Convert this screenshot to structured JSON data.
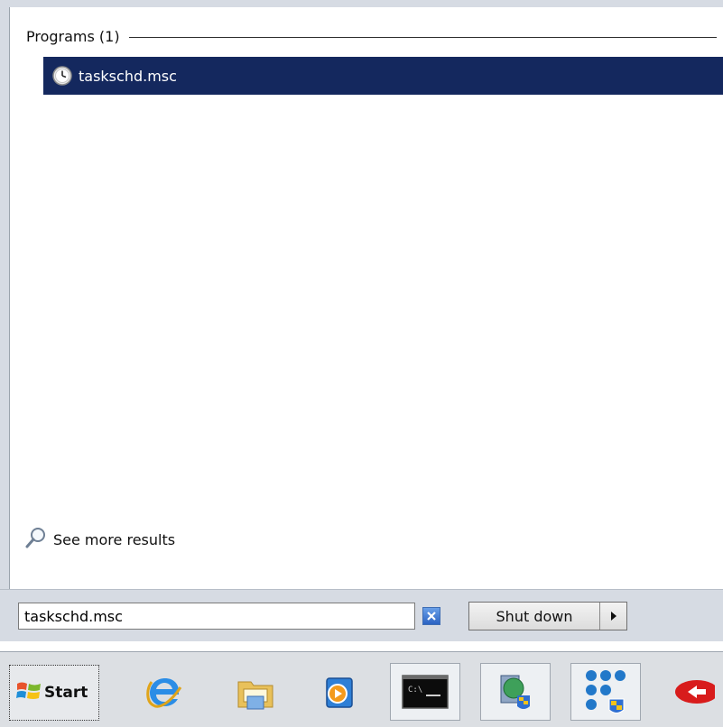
{
  "results": {
    "group_label": "Programs (1)",
    "items": [
      {
        "label": "taskschd.msc",
        "icon": "task-scheduler-clock-icon"
      }
    ],
    "see_more": "See more results"
  },
  "search": {
    "value": "taskschd.msc",
    "clear_icon": "clear-x-icon"
  },
  "shutdown": {
    "label": "Shut down",
    "arrow_icon": "triangle-right-icon"
  },
  "taskbar": {
    "start_label": "Start",
    "pinned": [
      {
        "name": "internet-explorer-icon"
      },
      {
        "name": "windows-explorer-icon"
      },
      {
        "name": "media-player-icon"
      },
      {
        "name": "command-prompt-icon"
      },
      {
        "name": "server-manager-icon"
      },
      {
        "name": "network-settings-icon"
      },
      {
        "name": "red-app-icon"
      }
    ]
  },
  "colors": {
    "selection": "#14285e",
    "panel": "#d6dbe3",
    "taskbar": "#dcdfe3"
  }
}
